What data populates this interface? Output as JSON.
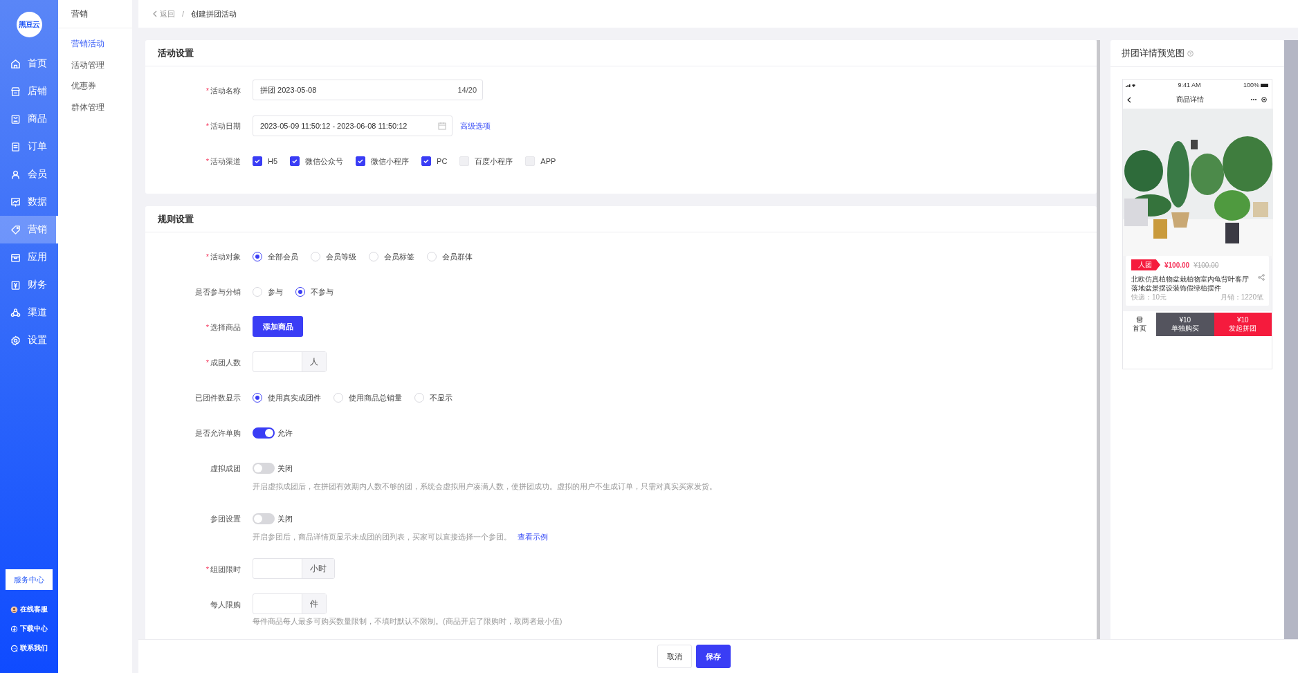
{
  "sidebar": {
    "logo": "黑豆云",
    "items": [
      {
        "label": "首页",
        "selected": false
      },
      {
        "label": "店铺",
        "selected": false
      },
      {
        "label": "商品",
        "selected": false
      },
      {
        "label": "订单",
        "selected": false
      },
      {
        "label": "会员",
        "selected": false
      },
      {
        "label": "数据",
        "selected": false
      },
      {
        "label": "营销",
        "selected": true
      },
      {
        "label": "应用",
        "selected": false
      },
      {
        "label": "财务",
        "selected": false
      },
      {
        "label": "渠道",
        "selected": false
      },
      {
        "label": "设置",
        "selected": false
      }
    ],
    "service_button": "服务中心",
    "links": [
      {
        "label": "在线客服"
      },
      {
        "label": "下载中心"
      },
      {
        "label": "联系我们"
      }
    ]
  },
  "submenu": {
    "title": "营销",
    "items": [
      {
        "label": "营销活动",
        "selected": true
      },
      {
        "label": "活动管理",
        "selected": false
      },
      {
        "label": "优惠券",
        "selected": false
      },
      {
        "label": "群体管理",
        "selected": false
      }
    ]
  },
  "breadcrumb": {
    "back": "返回",
    "separator": "/",
    "current": "创建拼团活动"
  },
  "sections": [
    {
      "title": "活动设置",
      "fields": [
        {
          "kind": "text",
          "label": "活动名称",
          "required_mark": "*",
          "value": "拼团  2023-05-08",
          "counter": "14/20"
        },
        {
          "kind": "daterange",
          "label": "活动日期",
          "required_mark": "*",
          "value": "2023-05-09 11:50:12 - 2023-06-08 11:50:12",
          "link": "高级选项"
        },
        {
          "kind": "checkboxes",
          "label": "活动渠道",
          "required_mark": "*",
          "options": [
            {
              "label": "H5",
              "checked": true
            },
            {
              "label": "微信公众号",
              "checked": true
            },
            {
              "label": "微信小程序",
              "checked": true
            },
            {
              "label": "PC",
              "checked": true
            },
            {
              "label": "百度小程序",
              "checked": false
            },
            {
              "label": "APP",
              "checked": false
            }
          ]
        }
      ]
    },
    {
      "title": "规则设置",
      "fields": [
        {
          "kind": "radios",
          "label": "活动对象",
          "required_mark": "*",
          "options": [
            {
              "label": "全部会员",
              "selected": true
            },
            {
              "label": "会员等级",
              "selected": false
            },
            {
              "label": "会员标签",
              "selected": false
            },
            {
              "label": "会员群体",
              "selected": false
            }
          ]
        },
        {
          "kind": "radios",
          "label": "是否参与分销",
          "options": [
            {
              "label": "参与",
              "selected": false
            },
            {
              "label": "不参与",
              "selected": true
            }
          ]
        },
        {
          "kind": "button",
          "label": "选择商品",
          "required_mark": "*",
          "button": "添加商品"
        },
        {
          "kind": "suffix_input",
          "label": "成团人数",
          "required_mark": "*",
          "suffix": "人"
        },
        {
          "kind": "radios",
          "label": "已团件数显示",
          "options": [
            {
              "label": "使用真实成团件",
              "selected": true
            },
            {
              "label": "使用商品总销量",
              "selected": false
            },
            {
              "label": "不显示",
              "selected": false
            }
          ]
        },
        {
          "kind": "toggle",
          "label": "是否允许单购",
          "on": true,
          "state_text": "允许"
        },
        {
          "kind": "toggle",
          "label": "虚拟成团",
          "on": false,
          "state_text": "关闭",
          "help": "开启虚拟成团后，在拼团有效期内人数不够的团，系统会虚拟用户凑满人数，使拼团成功。虚拟的用户不生成订单，只需对真实买家发货。"
        },
        {
          "kind": "toggle",
          "label": "参团设置",
          "on": false,
          "state_text": "关闭",
          "help": "开启参团后，商品详情页显示未成团的团列表，买家可以直接选择一个参团。",
          "help_link": "查看示例"
        },
        {
          "kind": "suffix_input",
          "label": "组团限时",
          "required_mark": "*",
          "suffix": "小时"
        },
        {
          "kind": "suffix_input",
          "label": "每人限购",
          "suffix": "件",
          "help": "每件商品每人最多可购买数量限制，不填时默认不限制。(商品开启了限购时，取两者最小值)"
        }
      ]
    }
  ],
  "footer": {
    "buttons": [
      {
        "label": "取消",
        "kind": "default"
      },
      {
        "label": "保存",
        "kind": "primary"
      }
    ]
  },
  "preview": {
    "title": "拼团详情预览图",
    "phone": {
      "time": "9:41 AM",
      "battery": "100%",
      "nav_title": "商品详情",
      "badge": "人团",
      "price": "¥100.00",
      "original_price": "¥100.00",
      "product_title": "北欧仿真植物盆栽植物室内龟背叶客厅落地盆景摆设装饰假绿植摆件",
      "shipping": "快递：10元",
      "sales": "月销：1220笔",
      "home": "首页",
      "actions": [
        {
          "price": "¥10",
          "label": "单独购买",
          "kind": "solo"
        },
        {
          "price": "¥10",
          "label": "发起拼团",
          "kind": "group"
        }
      ]
    }
  }
}
